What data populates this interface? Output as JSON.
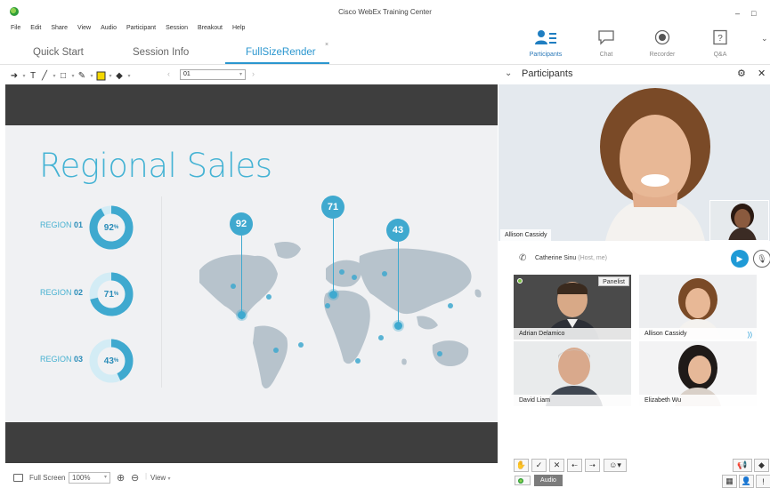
{
  "window": {
    "title": "Cisco WebEx Training Center",
    "minimize": "–",
    "maximize": "□"
  },
  "menu": [
    "File",
    "Edit",
    "Share",
    "View",
    "Audio",
    "Participant",
    "Session",
    "Breakout",
    "Help"
  ],
  "doc_tabs": [
    {
      "label": "Quick Start"
    },
    {
      "label": "Session Info"
    },
    {
      "label": "FullSizeRender",
      "active": true
    }
  ],
  "tab_close": "×",
  "toolbar": {
    "page_value": "01",
    "prev": "‹",
    "next": "›"
  },
  "slide": {
    "title": "Regional Sales",
    "regions": [
      {
        "label": "REGION",
        "number": "01",
        "percent": "92",
        "unit": "%",
        "value": 0.92
      },
      {
        "label": "REGION",
        "number": "02",
        "percent": "71",
        "unit": "%",
        "value": 0.71
      },
      {
        "label": "REGION",
        "number": "03",
        "percent": "43",
        "unit": "%",
        "value": 0.43
      }
    ],
    "pins": [
      "92",
      "71",
      "43"
    ],
    "accent": "#45b3d4"
  },
  "statusbar": {
    "full_screen": "Full Screen",
    "zoom": "100%",
    "view": "View"
  },
  "panel_tabs": [
    {
      "label": "Participants",
      "icon": "participants-icon",
      "active": true
    },
    {
      "label": "Chat",
      "icon": "chat-icon"
    },
    {
      "label": "Recorder",
      "icon": "record-icon"
    },
    {
      "label": "Q&A",
      "icon": "question-icon"
    }
  ],
  "panel": {
    "title": "Participants",
    "active_speaker": "Allison Cassidy",
    "caller_name": "Catherine Sinu",
    "caller_role": "(Host, me)"
  },
  "participants": [
    {
      "name": "Adrian Delamico",
      "badge": "Panelist"
    },
    {
      "name": "Allison Cassidy",
      "speaking": true
    },
    {
      "name": "David Liam"
    },
    {
      "name": "Elizabeth Wu"
    }
  ],
  "audio_label": "Audio"
}
